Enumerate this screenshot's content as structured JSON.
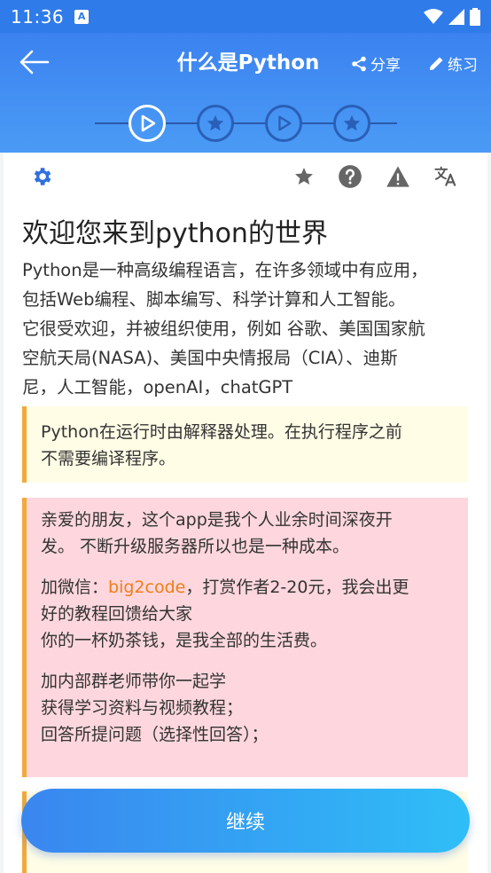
{
  "status_bar": {
    "time": "11:36",
    "notification_icon": "A"
  },
  "header": {
    "title": "什么是Python",
    "share_label": "分享",
    "practice_label": "练习",
    "steps": [
      {
        "icon": "play-icon",
        "active": true
      },
      {
        "icon": "star-icon",
        "active": false
      },
      {
        "icon": "play-icon",
        "active": false
      },
      {
        "icon": "star-icon",
        "active": false
      }
    ]
  },
  "content": {
    "heading": "欢迎您来到python的世界",
    "intro_lines": [
      "Python是一种高级编程语言，在许多领域中有应用，",
      "包括Web编程、脚本编写、科学计算和人工智能。",
      "它很受欢迎，并被组织使用，例如 谷歌、美国国家航",
      "空航天局(NASA)、美国中央情报局（CIA）、迪斯",
      "尼，人工智能，openAI，chatGPT"
    ],
    "note_yellow_lines": [
      "Python在运行时由解释器处理。在执行程序之前",
      "不需要编译程序。"
    ],
    "note_pink": {
      "p1_lines": [
        "亲爱的朋友，这个app是我个人业余时间深夜开",
        "发。 不断升级服务器所以也是一种成本。"
      ],
      "p2_prefix": "加微信：",
      "p2_wechat": "big2code",
      "p2_suffix": "，打赏作者2-20元，我会出更",
      "p2_lines": [
        "好的教程回馈给大家",
        "你的一杯奶茶钱，是我全部的生活费。"
      ],
      "p3_lines": [
        "加内部群老师带你一起学",
        "获得学习资料与视频教程；",
        "回答所提问题（选择性回答）；"
      ]
    }
  },
  "continue_label": "继续",
  "colors": {
    "header_blue": "#3b82f0",
    "accent_orange": "#f07d17",
    "note_border": "#f2a93b",
    "settings_blue": "#2f6fe0"
  }
}
